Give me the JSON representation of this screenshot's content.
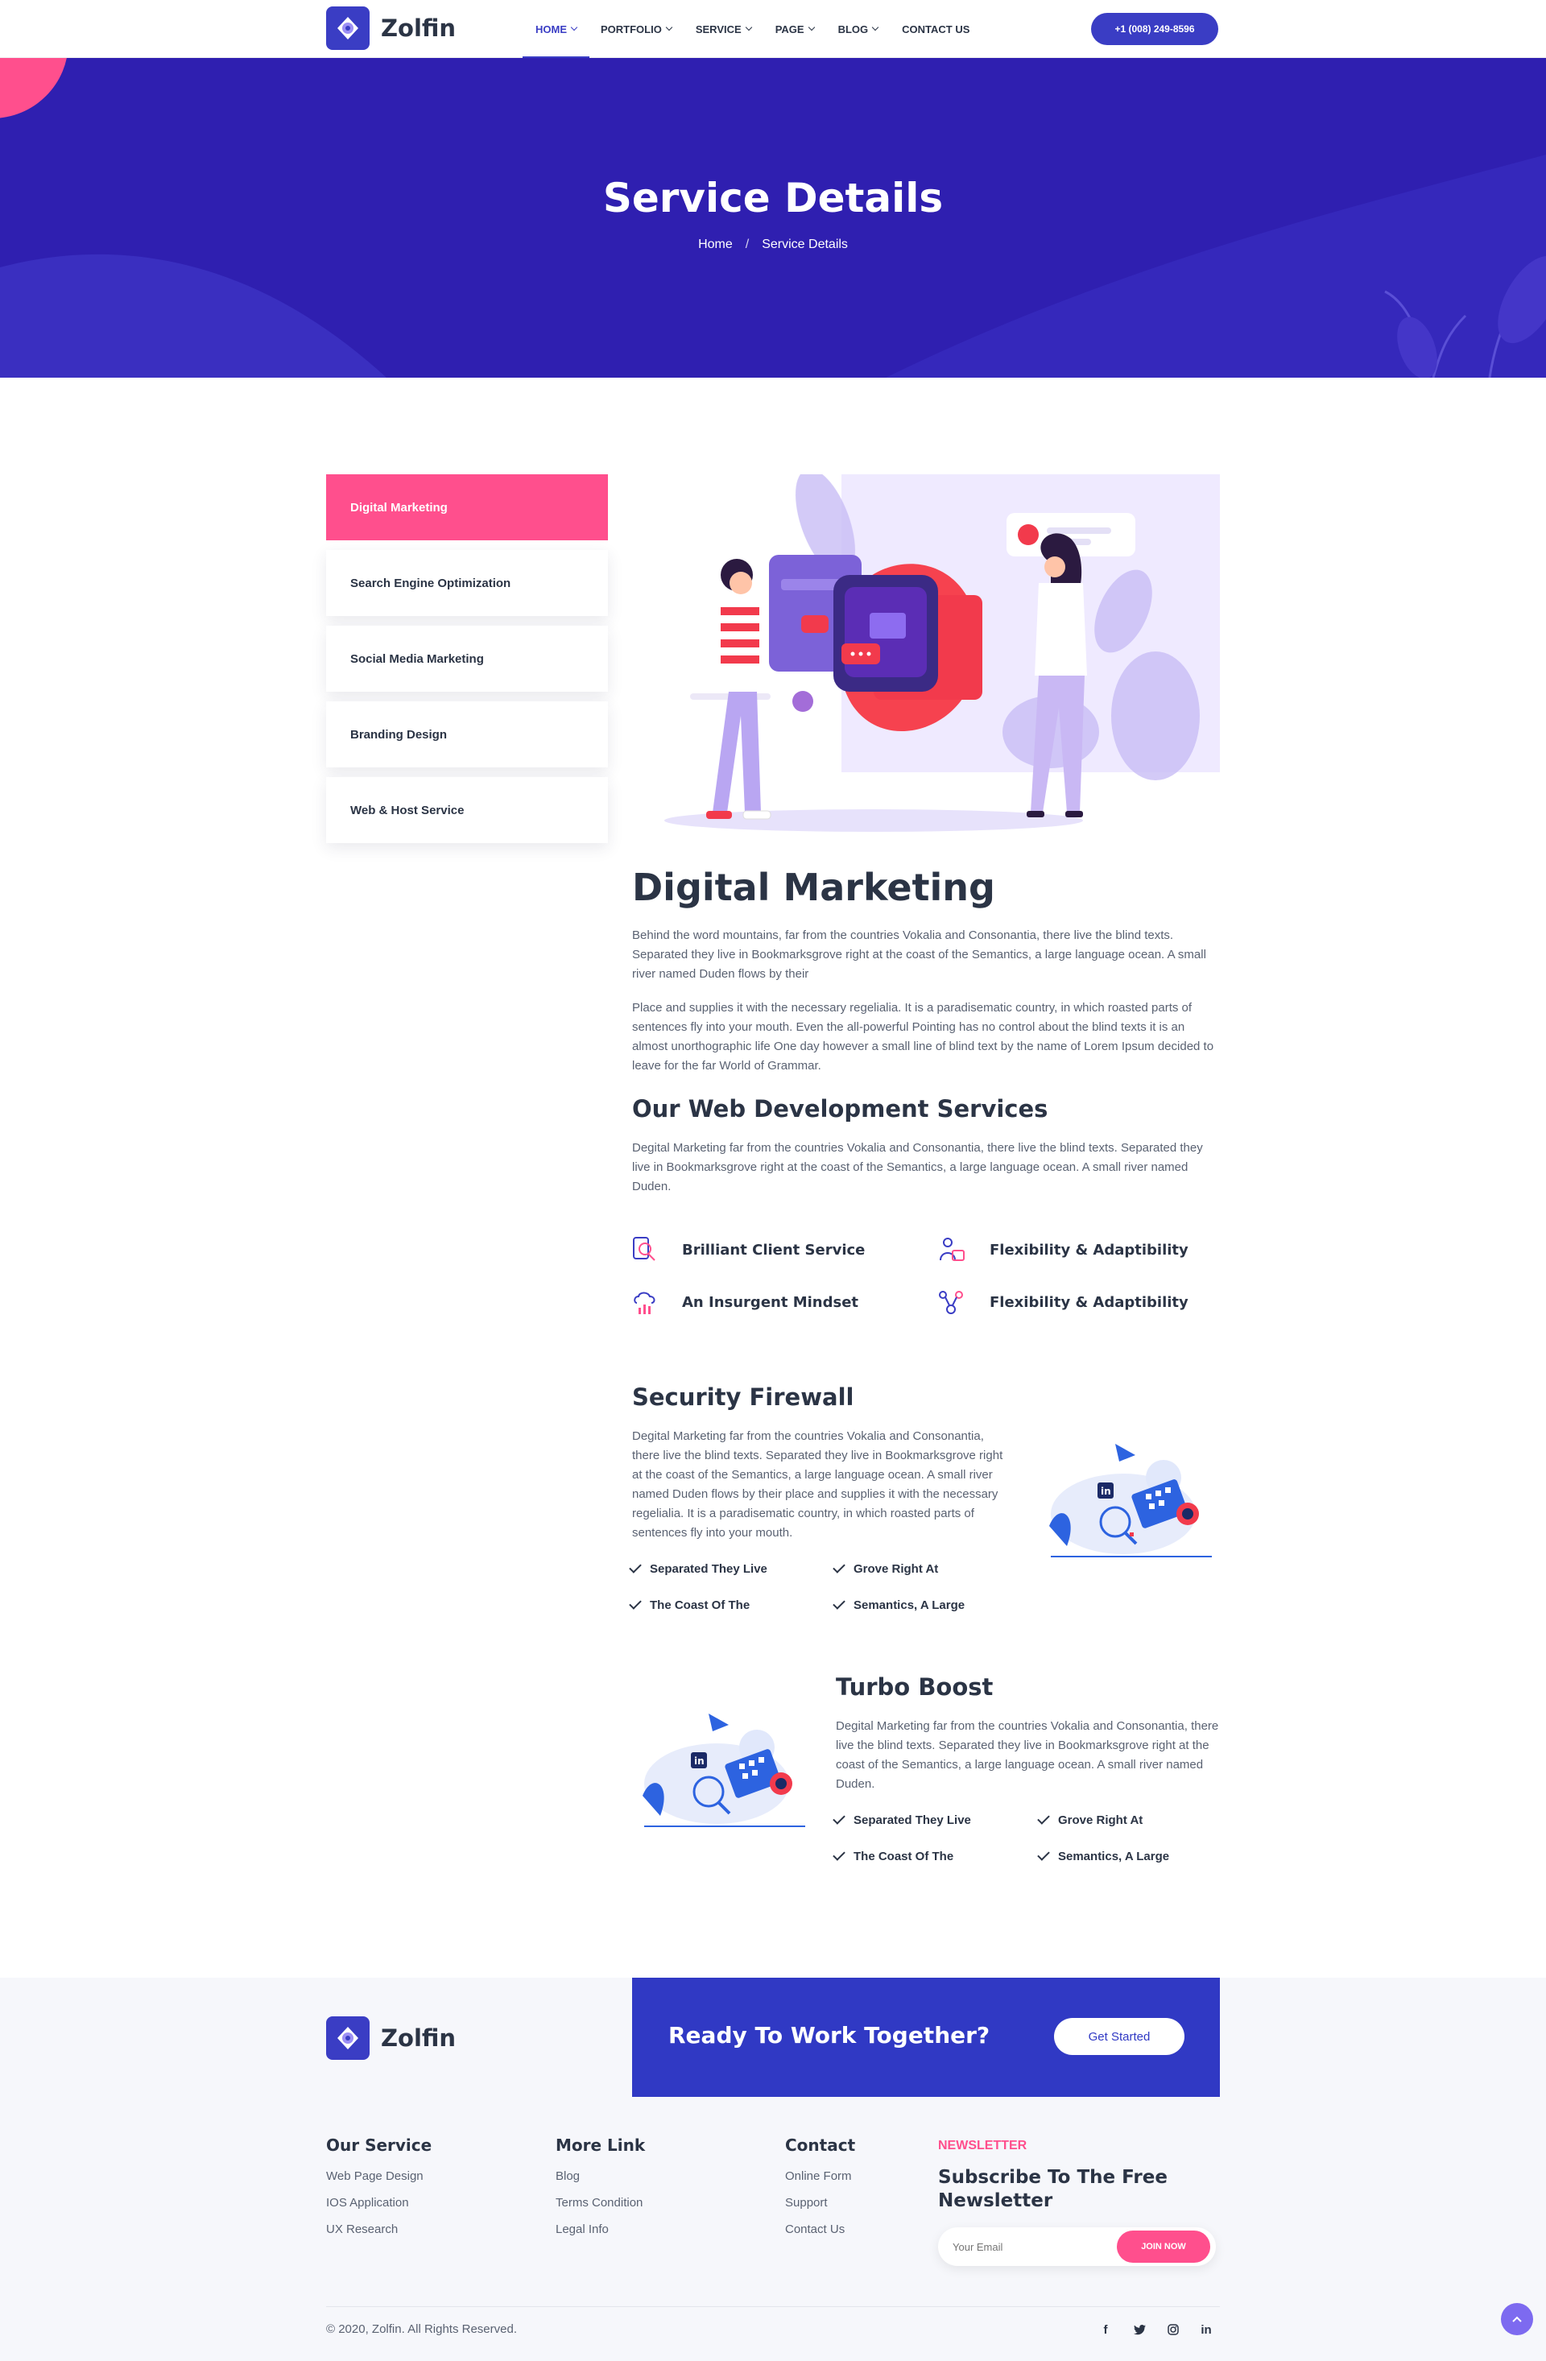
{
  "brand": {
    "name": "Zolfin"
  },
  "nav": {
    "items": [
      {
        "label": "HOME",
        "dropdown": true,
        "active": true
      },
      {
        "label": "PORTFOLIO",
        "dropdown": true
      },
      {
        "label": "SERVICE",
        "dropdown": true
      },
      {
        "label": "PAGE",
        "dropdown": true
      },
      {
        "label": "BLOG",
        "dropdown": true
      },
      {
        "label": "CONTACT US",
        "dropdown": false
      }
    ],
    "phone": "+1 (008) 249-8596"
  },
  "hero": {
    "title": "Service Details",
    "breadcrumb": [
      "Home",
      "/",
      "Service Details"
    ]
  },
  "sidebar": {
    "items": [
      {
        "label": "Digital Marketing",
        "active": true
      },
      {
        "label": "Search Engine Optimization"
      },
      {
        "label": "Social Media Marketing"
      },
      {
        "label": "Branding Design"
      },
      {
        "label": "Web & Host Service"
      }
    ]
  },
  "main": {
    "title": "Digital Marketing",
    "para1": "Behind the word mountains, far from the countries Vokalia and Consonantia, there live the blind texts. Separated they live in Bookmarksgrove right at the coast of the Semantics, a large language ocean. A small river named Duden flows by their",
    "para2": "Place and supplies it with the necessary regelialia. It is a paradisematic country, in which roasted parts of sentences fly into your mouth. Even the all-powerful Pointing has no control about the blind texts it is an almost unorthographic life One day however a small line of blind text by the name of Lorem Ipsum decided to leave for the far World of Grammar.",
    "services_title": "Our Web Development Services",
    "services_text": "Degital Marketing far from the countries Vokalia and Consonantia, there live the blind texts. Separated they live in Bookmarksgrove right at the coast of the Semantics, a large language ocean. A small river named Duden.",
    "features": [
      {
        "label": "Brilliant Client Service",
        "icon": "client-service-icon"
      },
      {
        "label": "Flexibility & Adaptibility",
        "icon": "flexibility-icon"
      },
      {
        "label": "An Insurgent Mindset",
        "icon": "cloud-chart-icon"
      },
      {
        "label": "Flexibility & Adaptibility",
        "icon": "network-icon"
      }
    ],
    "security": {
      "title": "Security Firewall",
      "text": "Degital Marketing far from the countries Vokalia and Consonantia, there live the blind texts. Separated they live in Bookmarksgrove right at the coast of the Semantics, a large language ocean. A small river named Duden flows by their place and supplies it with the necessary regelialia. It is a paradisematic country, in which roasted parts of sentences fly into your mouth.",
      "checks": [
        "Separated They Live",
        "Grove Right At",
        "The Coast Of The",
        "Semantics, A Large"
      ]
    },
    "turbo": {
      "title": "Turbo Boost",
      "text": "Degital Marketing far from the countries Vokalia and Consonantia, there live the blind texts. Separated they live in Bookmarksgrove right at the coast of the Semantics, a large language ocean. A small river named Duden.",
      "checks": [
        "Separated They Live",
        "Grove Right At",
        "The Coast Of The",
        "Semantics, A Large"
      ]
    }
  },
  "footer": {
    "cta_title": "Ready To Work Together?",
    "cta_button": "Get Started",
    "col1": {
      "title": "Our Service",
      "links": [
        "Web Page Design",
        "IOS Application",
        "UX Research"
      ]
    },
    "col2": {
      "title": "More Link",
      "links": [
        "Blog",
        "Terms Condition",
        "Legal Info"
      ]
    },
    "col3": {
      "title": "Contact",
      "links": [
        "Online Form",
        "Support",
        "Contact Us"
      ]
    },
    "newsletter": {
      "label": "NEWSLETTER",
      "title": "Subscribe To The Free Newsletter",
      "placeholder": "Your Email",
      "button": "JOIN NOW"
    },
    "copyright": "© 2020, Zolfin. All Rights Reserved.",
    "social": [
      "facebook-icon",
      "twitter-icon",
      "instagram-icon",
      "linkedin-icon"
    ]
  },
  "colors": {
    "primary": "#3a3dc4",
    "hero_bg": "#2f1fb0",
    "accent_pink": "#ff4f8d",
    "heading": "#2b3445"
  }
}
